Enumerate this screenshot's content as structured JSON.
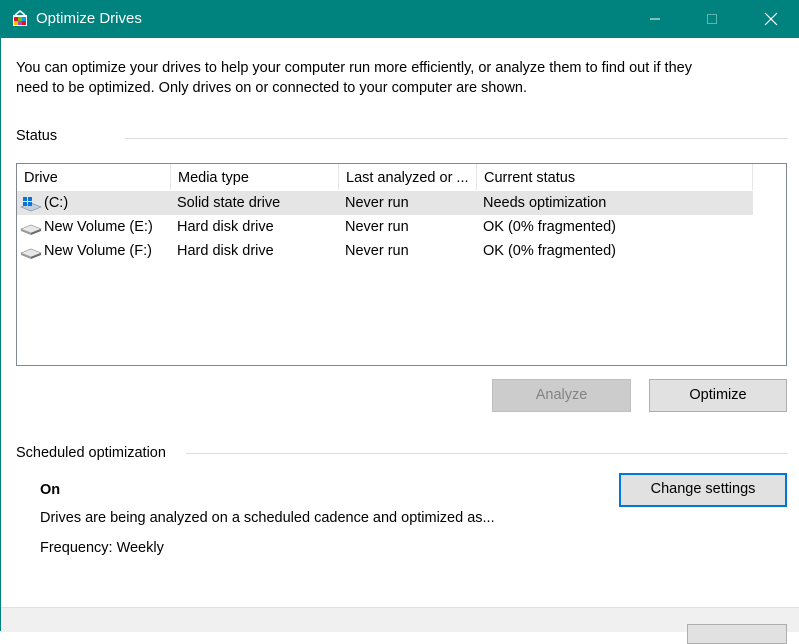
{
  "window": {
    "title": "Optimize Drives",
    "title_bar_color": "#00827f",
    "controls": [
      "minimize-icon",
      "maximize-icon",
      "close-icon"
    ]
  },
  "intro": {
    "line1": "You can optimize your drives to help your computer run more efficiently, or analyze them to find out if they",
    "line2": "need to be optimized. Only drives on or connected to your computer are shown."
  },
  "status": {
    "label": "Status",
    "columns": [
      "Drive",
      "Media type",
      "Last analyzed or ...",
      "Current status"
    ],
    "drives": [
      {
        "icon": "system-drive-icon",
        "drive": "(C:)",
        "media_type": "Solid state drive",
        "last_analyzed": "Never run",
        "current_status": "Needs optimization",
        "selected": true
      },
      {
        "icon": "hard-drive-icon",
        "drive": "New Volume (E:)",
        "media_type": "Hard disk drive",
        "last_analyzed": "Never run",
        "current_status": "OK (0% fragmented)",
        "selected": false
      },
      {
        "icon": "hard-drive-icon",
        "drive": "New Volume (F:)",
        "media_type": "Hard disk drive",
        "last_analyzed": "Never run",
        "current_status": "OK (0% fragmented)",
        "selected": false
      }
    ],
    "analyze_label": "Analyze",
    "analyze_enabled": false,
    "optimize_label": "Optimize"
  },
  "scheduled": {
    "label": "Scheduled optimization",
    "state": "On",
    "description": "Drives are being analyzed on a scheduled cadence and optimized as...",
    "frequency": "Frequency: Weekly",
    "change_settings_label": "Change settings"
  }
}
